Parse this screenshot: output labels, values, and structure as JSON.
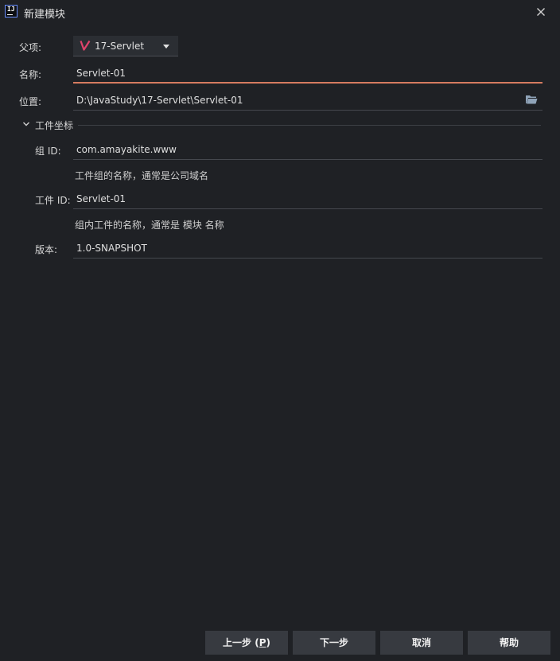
{
  "window": {
    "title": "新建模块",
    "app_icon_text": "IJ"
  },
  "form": {
    "parent": {
      "label": "父项:",
      "value": "17-Servlet"
    },
    "name": {
      "label": "名称:",
      "value": "Servlet-01"
    },
    "location": {
      "label": "位置:",
      "value": "D:\\JavaStudy\\17-Servlet\\Servlet-01"
    }
  },
  "artifact_section": {
    "title": "工件坐标",
    "group_id": {
      "label": "组 ID:",
      "value": "com.amayakite.www",
      "hint": "工件组的名称，通常是公司域名"
    },
    "artifact_id": {
      "label": "工件 ID:",
      "value": "Servlet-01",
      "hint": "组内工件的名称，通常是 模块 名称"
    },
    "version": {
      "label": "版本:",
      "value": "1.0-SNAPSHOT"
    }
  },
  "buttons": {
    "previous": {
      "text": "上一步 (",
      "mnemonic": "P",
      "suffix": ")"
    },
    "next": "下一步",
    "cancel": "取消",
    "help": "帮助"
  },
  "colors": {
    "background": "#1f2125",
    "focus_underline": "#d57b60",
    "button_bg": "#373a40",
    "folder_icon": "#8fa3b8",
    "parent_icon": "#e0436b"
  }
}
